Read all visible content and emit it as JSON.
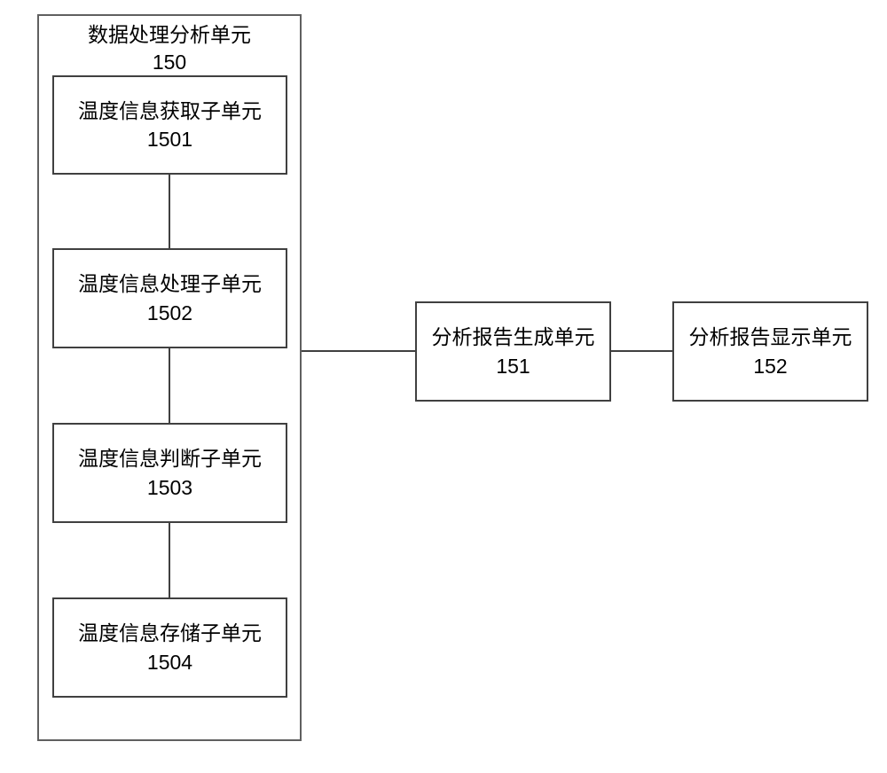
{
  "outer": {
    "title": "数据处理分析单元",
    "code": "150"
  },
  "subunits": [
    {
      "title": "温度信息获取子单元",
      "code": "1501"
    },
    {
      "title": "温度信息处理子单元",
      "code": "1502"
    },
    {
      "title": "温度信息判断子单元",
      "code": "1503"
    },
    {
      "title": "温度信息存储子单元",
      "code": "1504"
    }
  ],
  "gen": {
    "title": "分析报告生成单元",
    "code": "151"
  },
  "disp": {
    "title": "分析报告显示单元",
    "code": "152"
  }
}
